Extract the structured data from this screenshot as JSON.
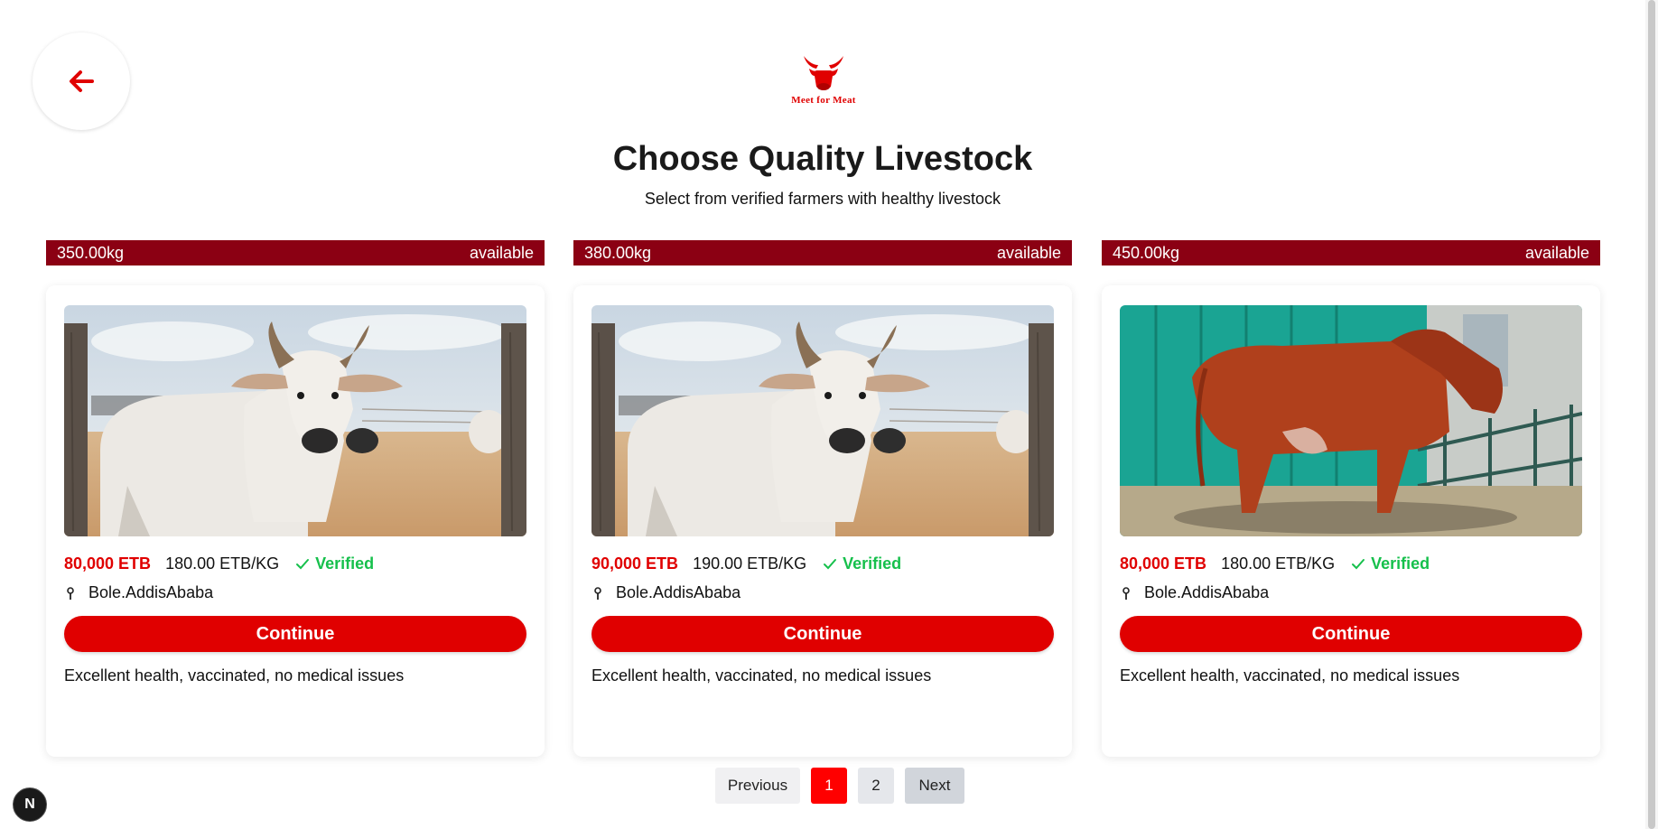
{
  "header": {
    "back_icon": "arrow-left-icon",
    "logo_icon": "bull-head-icon",
    "logo_text": "Meet for Meat",
    "title": "Choose Quality Livestock",
    "subtitle": "Select from verified farmers with healthy livestock"
  },
  "colors": {
    "brand_red": "#e00000",
    "ribbon": "#8b0013",
    "verified_green": "#16c04c"
  },
  "listings": [
    {
      "weight": "350.00kg",
      "status": "available",
      "image": "white-zebu-cow-photo",
      "price": "80,000 ETB",
      "price_per_kg": "180.00 ETB/KG",
      "verified": "Verified",
      "location": "Bole.AddisAbaba",
      "button": "Continue",
      "description": "Excellent health, vaccinated, no medical issues"
    },
    {
      "weight": "380.00kg",
      "status": "available",
      "image": "white-zebu-cow-photo",
      "price": "90,000 ETB",
      "price_per_kg": "190.00 ETB/KG",
      "verified": "Verified",
      "location": "Bole.AddisAbaba",
      "button": "Continue",
      "description": "Excellent health, vaccinated, no medical issues"
    },
    {
      "weight": "450.00kg",
      "status": "available",
      "image": "red-cow-photo",
      "price": "80,000 ETB",
      "price_per_kg": "180.00 ETB/KG",
      "verified": "Verified",
      "location": "Bole.AddisAbaba",
      "button": "Continue",
      "description": "Excellent health, vaccinated, no medical issues"
    }
  ],
  "pagination": {
    "previous": "Previous",
    "pages": [
      "1",
      "2"
    ],
    "current": "1",
    "next": "Next"
  },
  "dev_badge": "N"
}
